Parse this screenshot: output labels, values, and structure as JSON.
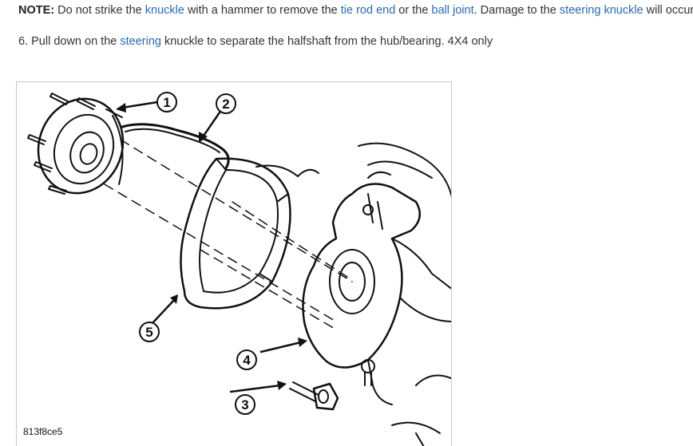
{
  "note": {
    "label": "NOTE:",
    "t1": " Do not strike the ",
    "link1": "knuckle",
    "t2": " with a hammer to remove the ",
    "link2": "tie rod end",
    "t3": " or the ",
    "link3": "ball joint",
    "t4": ". Damage to the ",
    "link4": "steering knuckle",
    "t5": " will occur."
  },
  "step": {
    "t1": "6. Pull down on the ",
    "link1": "steering",
    "t2": " knuckle to separate the halfshaft from the hub/bearing. 4X4 only"
  },
  "figure": {
    "id": "813f8ce5",
    "callouts": [
      "1",
      "2",
      "3",
      "4",
      "5"
    ],
    "colors": {
      "link": "#2a6ab0",
      "ink": "#111111",
      "border": "#c8c8c8"
    }
  }
}
